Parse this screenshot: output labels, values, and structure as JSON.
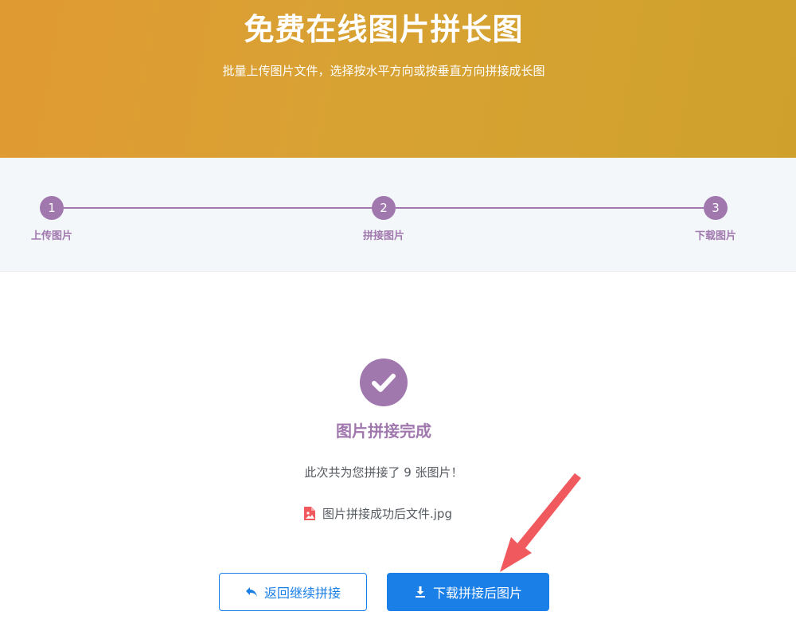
{
  "hero": {
    "title": "免费在线图片拼长图",
    "subtitle": "批量上传图片文件，选择按水平方向或按垂直方向拼接成长图"
  },
  "steps": [
    {
      "number": "1",
      "label": "上传图片"
    },
    {
      "number": "2",
      "label": "拼接图片"
    },
    {
      "number": "3",
      "label": "下载图片"
    }
  ],
  "result": {
    "title": "图片拼接完成",
    "summary": "此次共为您拼接了 9 张图片！",
    "file_name": "图片拼接成功后文件.jpg"
  },
  "actions": {
    "back_label": "返回继续拼接",
    "download_label": "下载拼接后图片"
  },
  "colors": {
    "accent": "#a078ae",
    "primary": "#1b7fe8",
    "hero": "#d8a233",
    "arrow": "#f05a5f"
  },
  "icons": {
    "check": "check-icon",
    "file": "image-file-icon",
    "back": "undo-icon",
    "download": "download-icon",
    "pointer": "arrow-pointer"
  }
}
